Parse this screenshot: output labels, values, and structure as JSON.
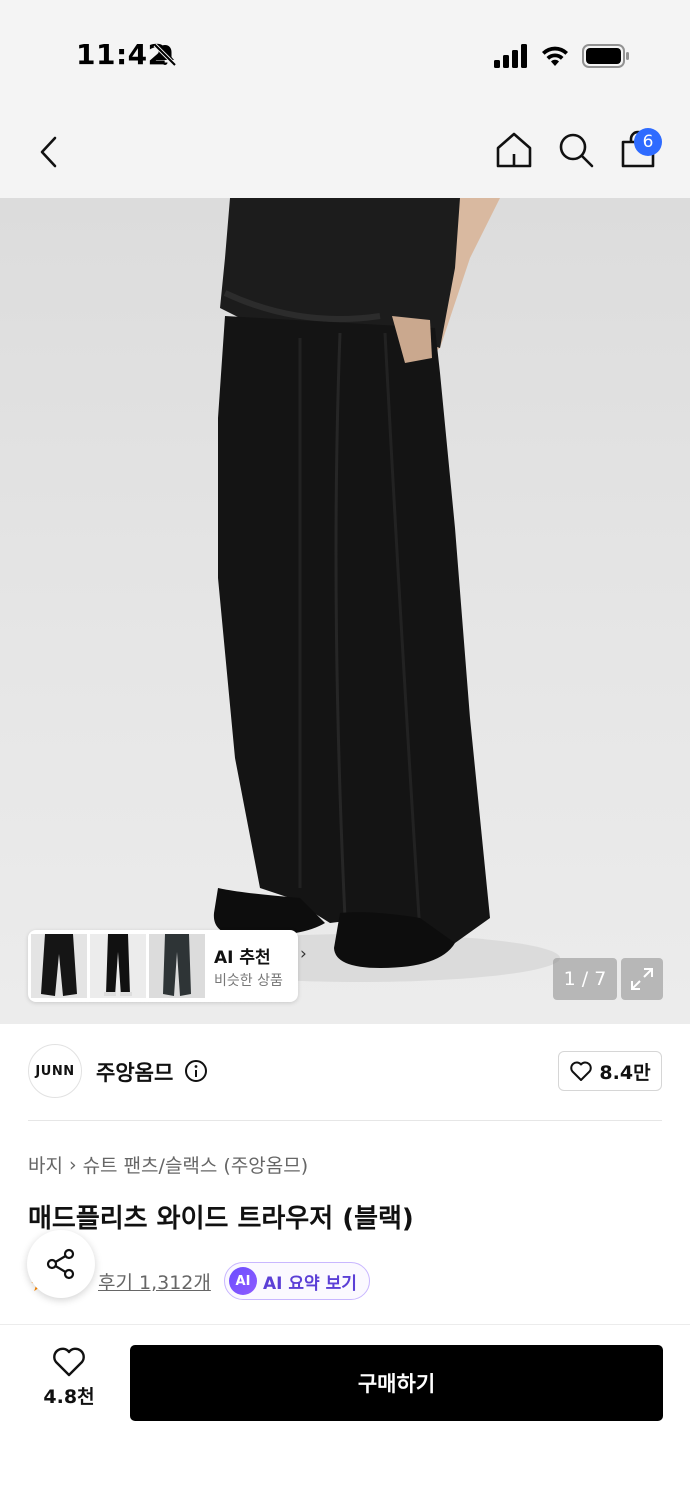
{
  "status_bar": {
    "time": "11:42"
  },
  "nav": {
    "cart_count": "6"
  },
  "gallery": {
    "page_indicator": "1 / 7"
  },
  "recommendation": {
    "title": "AI 추천",
    "subtitle": "비슷한 상품"
  },
  "brand": {
    "logo_text": "JUNN",
    "name": "주앙옴므",
    "likes": "8.4만"
  },
  "breadcrumb": {
    "category": "바지",
    "subcategory": "슈트 팬츠/슬랙스 (주앙옴므)"
  },
  "product": {
    "title": "매드플리츠 와이드 트라우저 (블랙)"
  },
  "reviews": {
    "link_text": "후기 1,312개",
    "ai_badge": "AI",
    "ai_summary_label": "AI 요약 보기"
  },
  "bottom_bar": {
    "wish_count": "4.8천",
    "buy_label": "구매하기"
  },
  "colors": {
    "accent": "#2e6bff",
    "ai_purple": "#5b3fd6",
    "buy_button": "#000000"
  },
  "icons": [
    "bell-off-icon",
    "signal-icon",
    "wifi-icon",
    "battery-icon",
    "back-icon",
    "home-icon",
    "search-icon",
    "bag-icon",
    "expand-icon",
    "info-icon",
    "heart-icon",
    "share-icon",
    "star-icon"
  ]
}
